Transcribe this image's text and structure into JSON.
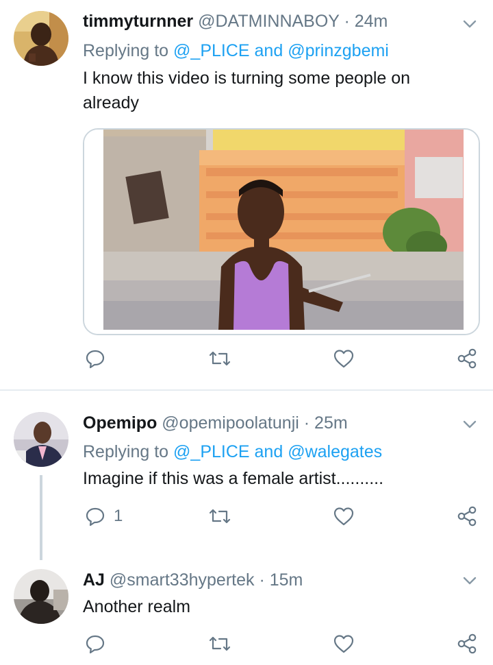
{
  "tweets": [
    {
      "display_name": "timmyturnner",
      "handle": "@DATMINNABOY",
      "separator": "·",
      "time": "24m",
      "replying_prefix": "Replying to",
      "mention_1": "@_PLICE",
      "conjunction": "and",
      "mention_2": "@prinzgbemi",
      "text": "I know this video is turning some people on already",
      "reply_count": "",
      "has_media": true
    },
    {
      "display_name": "Opemipo",
      "handle": "@opemipoolatunji",
      "separator": "·",
      "time": "25m",
      "replying_prefix": "Replying to",
      "mention_1": "@_PLICE",
      "conjunction": "and",
      "mention_2": "@walegates",
      "text": "Imagine if this was a female artist..........",
      "reply_count": "1",
      "has_media": false
    },
    {
      "display_name": "AJ",
      "handle": "@smart33hypertek",
      "separator": "·",
      "time": "15m",
      "text": "Another realm",
      "reply_count": "",
      "has_media": false
    }
  ],
  "icons": {
    "reply": "reply-bubble-icon",
    "retweet": "retweet-icon",
    "like": "heart-icon",
    "share": "share-icon",
    "menu": "chevron-down-icon"
  },
  "colors": {
    "name": "#14171a",
    "meta": "#657786",
    "mention": "#1da1f2",
    "border": "#ccd6dd",
    "divider": "#e6ecf0"
  }
}
